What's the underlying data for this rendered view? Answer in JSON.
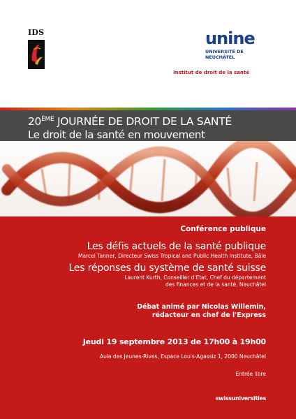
{
  "header": {
    "ids_logo_text": "IDS",
    "unine_logo_text": "unine",
    "university_line1": "UNIVERSITÉ DE",
    "university_line2": "NEUCHÂTEL",
    "institut": "Institut de droit de la santé"
  },
  "banner": {
    "title_number": "20",
    "title_ordinal": "ÈME",
    "title_rest": " JOURNÉE DE DROIT DE LA SANTÉ",
    "subtitle": "Le droit de la santé en mouvement"
  },
  "program": {
    "conference": "Conférence publique",
    "talk1_title": "Les défis actuels de la santé publique",
    "talk1_speaker": "Marcel Tanner,  Directeur Swiss Tropical and Public Health Institute, Bâle",
    "talk2_title": "Les réponses du système de santé suisse",
    "talk2_speaker_line1": "Laurent Kurth, Conseiller d'Etat, Chef du département",
    "talk2_speaker_line2": "des finances et de la santé, Neuchâtel",
    "debate_line1": "Débat animé par Nicolas Willemin,",
    "debate_line2": "rédacteur en chef de l'Express",
    "date": "Jeudi 19 septembre 2013 de 17h00 à 19h00",
    "location": "Aula des Jeunes-Rives, Espace Louis-Agassiz 1, 2000 Neuchâtel",
    "entry": "Entrée libre",
    "sponsor": "swissuniversities"
  },
  "colors": {
    "red": "#c41a1a",
    "banner_gray": "#4b4a49",
    "unine_blue": "#1b3f8f"
  }
}
